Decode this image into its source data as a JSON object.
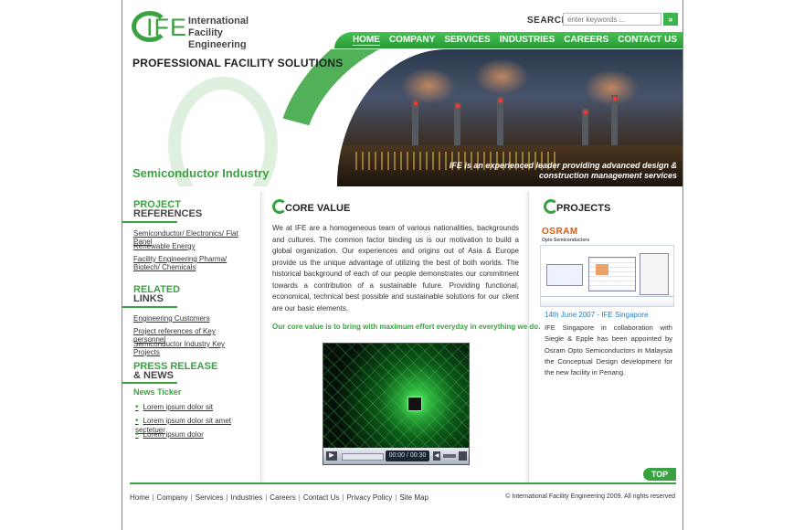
{
  "header": {
    "logo_mark": "IFE",
    "logo_line1": "International",
    "logo_line2": "Facility Engineering",
    "search_label": "SEARCH",
    "search_placeholder": "enter keywords ...",
    "search_button": "»"
  },
  "nav": {
    "items": [
      "HOME",
      "COMPANY",
      "SERVICES",
      "INDUSTRIES",
      "CAREERS",
      "CONTACT US"
    ],
    "active": "HOME"
  },
  "banner": {
    "title": "PROFESSIONAL FACILITY SOLUTIONS",
    "sector": "Semiconductor Industry",
    "tagline": "IFE is an experienced leader providing advanced design & construction management services"
  },
  "sidebar": {
    "project_references": {
      "heading_top": "PROJECT",
      "heading_bottom": "REFERENCES",
      "links": [
        "Semiconductor/ Electronics/ Flat Panel",
        "Renewable Energy",
        "Facility Engineering Pharma/ Biotech/ Chemicals"
      ]
    },
    "related_links": {
      "heading_top": "RELATED",
      "heading_bottom": "LINKS",
      "links": [
        "Engineering Customers",
        "Project references of Key personnel",
        "Semiconductor Industry Key Projects"
      ]
    },
    "press_release": {
      "heading_top": "PRESS RELEASE",
      "heading_bottom": "& NEWS",
      "ticker_label": "News Ticker",
      "items": [
        "Lorem ipsum dolor sit",
        "Lorem ipsum dolor sit amet sectetuer",
        "Lorem ipsum dolor"
      ]
    }
  },
  "core_value": {
    "title": "CORE VALUE",
    "body": "We at IFE are a homogeneous team of various nationalities, backgrounds and cultures. The common factor binding us is our motivation to build a global organization. Our experiences and origins out of Asia & Europe provide us the unique advantage of utilizing the best of both worlds. The historical background of each of our people demonstrates our commitment towards a contribution of a sustainable future. Providing functional, economical, technical best possible and sustainable solutions for our client are our basic elements.",
    "highlight": "Our core value is to bring with maximum effort everyday in everything we do.",
    "video": {
      "time": "00:00 / 00:30"
    }
  },
  "projects": {
    "title": "PROJECTS",
    "client_logo": "OSRAM",
    "client_sub": "Opto Semiconductors",
    "news_date": "14th June 2007 -  IFE  Singapore",
    "news_body": "IFE Singapore in collaboration with Siegle & Epple has been appointed by Osram Opto Semiconductors in Malaysia the Conceptual Design development for the new facility in Penang."
  },
  "top_button": "TOP",
  "footer": {
    "links": [
      "Home",
      "Company",
      "Services",
      "Industries",
      "Careers",
      "Contact Us",
      "Privacy Policy",
      "Site Map"
    ],
    "copyright": "© International Facility Engineering 2009. All rights reserved"
  },
  "colors": {
    "brand_green": "#3aa241",
    "link_blue": "#1e7fc7",
    "osram_orange": "#e05a0a"
  }
}
